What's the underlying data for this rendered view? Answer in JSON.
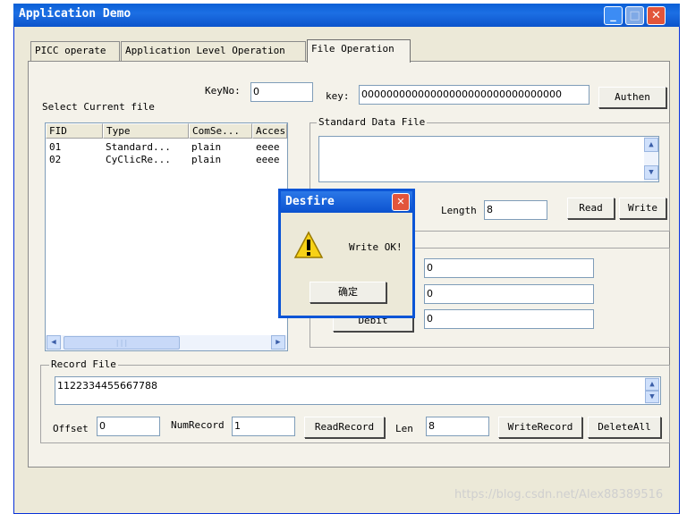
{
  "window": {
    "title": "Application Demo"
  },
  "tabs": [
    {
      "label": "PICC operate"
    },
    {
      "label": "Application Level Operation"
    },
    {
      "label": "File Operation"
    }
  ],
  "select_file_label": "Select Current file",
  "keyno": {
    "label": "KeyNo:",
    "value": "0"
  },
  "key": {
    "label": "key:",
    "value": "00000000000000000000000000000000"
  },
  "authen_button": "Authen",
  "file_list": {
    "columns": [
      "FID",
      "Type",
      "ComSe...",
      "Acces"
    ],
    "rows": [
      [
        "01",
        "Standard...",
        "plain",
        "eeee"
      ],
      [
        "02",
        "CyClicRe...",
        "plain",
        "eeee"
      ]
    ]
  },
  "standard_file": {
    "title": "Standard Data File",
    "content": "",
    "length_label": "Length",
    "length_value": "8",
    "read_button": "Read",
    "write_button": "Write"
  },
  "value_file": {
    "field1": "0",
    "field2": "0",
    "field3": "0",
    "debit_button": "Debit"
  },
  "record_file": {
    "title": "Record File",
    "content": "1122334455667788",
    "offset_label": "Offset",
    "offset_value": "0",
    "numrecord_label": "NumRecord",
    "numrecord_value": "1",
    "readrecord_button": "ReadRecord",
    "len_label": "Len",
    "len_value": "8",
    "writerecord_button": "WriteRecord",
    "deleteall_button": "DeleteAll"
  },
  "dialog": {
    "title": "Desfire",
    "message": "Write OK!",
    "ok_button": "确定"
  },
  "watermark": "https://blog.csdn.net/Alex88389516",
  "colors": {
    "titlebar": "#0a5fd6",
    "window_bg": "#ece9d8",
    "panel_bg": "#f4f2ea",
    "close_button": "#e2553b"
  }
}
